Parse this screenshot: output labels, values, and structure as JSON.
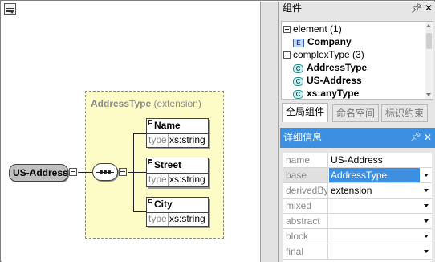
{
  "canvas": {
    "extension_box": {
      "type_name": "AddressType",
      "derivation": "(extension)"
    },
    "root_element": "US-Address",
    "elements": [
      {
        "name": "Name",
        "type_label": "type",
        "type_value": "xs:string"
      },
      {
        "name": "Street",
        "type_label": "type",
        "type_value": "xs:string"
      },
      {
        "name": "City",
        "type_label": "type",
        "type_value": "xs:string"
      }
    ]
  },
  "components_panel": {
    "title": "组件",
    "pin_icon": "pin-icon",
    "close_icon": "close-icon",
    "tree": {
      "groups": [
        {
          "label": "element (1)",
          "items": [
            {
              "name": "Company",
              "icon": "E"
            }
          ]
        },
        {
          "label": "complexType (3)",
          "items": [
            {
              "name": "AddressType",
              "icon": "C"
            },
            {
              "name": "US-Address",
              "icon": "C"
            },
            {
              "name": "xs:anyType",
              "icon": "C"
            }
          ]
        }
      ]
    },
    "tabs": [
      "全局组件",
      "命名空间",
      "标识约束"
    ],
    "active_tab": 0
  },
  "details_panel": {
    "title": "详细信息",
    "properties": [
      {
        "name": "name",
        "value": "US-Address",
        "dropdown": false
      },
      {
        "name": "base",
        "value": "AddressType",
        "dropdown": true,
        "selected": true
      },
      {
        "name": "derivedBy",
        "value": "extension",
        "dropdown": true
      },
      {
        "name": "mixed",
        "value": "",
        "dropdown": true
      },
      {
        "name": "abstract",
        "value": "",
        "dropdown": true
      },
      {
        "name": "block",
        "value": "",
        "dropdown": true
      },
      {
        "name": "final",
        "value": "",
        "dropdown": true
      }
    ]
  },
  "colors": {
    "extension_fill": "#fdfcc6",
    "header_accent": "#3d8fe1",
    "root_fill": "#c0c0c0"
  }
}
